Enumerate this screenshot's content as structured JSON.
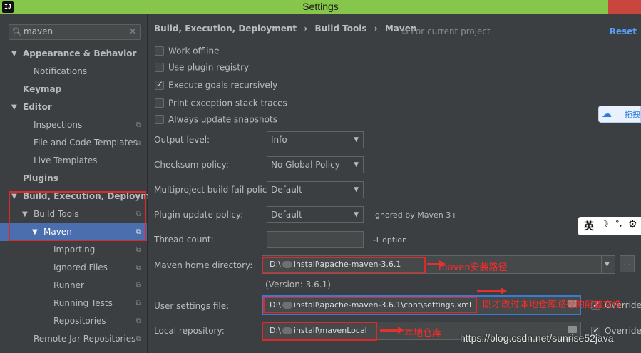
{
  "window": {
    "title": "Settings",
    "app_icon_text": "IJ"
  },
  "search": {
    "value": "maven",
    "clear": "✕"
  },
  "sidebar": {
    "items": [
      {
        "label": "Appearance & Behavior",
        "arrow": "▼"
      },
      {
        "label": "Notifications"
      },
      {
        "label": "Keymap"
      },
      {
        "label": "Editor",
        "arrow": "▼"
      },
      {
        "label": "Inspections"
      },
      {
        "label": "File and Code Templates"
      },
      {
        "label": "Live Templates"
      },
      {
        "label": "Plugins"
      },
      {
        "label": "Build, Execution, Deployment",
        "arrow": "▼"
      },
      {
        "label": "Build Tools",
        "arrow": "▼"
      },
      {
        "label": "Maven",
        "arrow": "▼"
      },
      {
        "label": "Importing"
      },
      {
        "label": "Ignored Files"
      },
      {
        "label": "Runner"
      },
      {
        "label": "Running Tests"
      },
      {
        "label": "Repositories"
      },
      {
        "label": "Remote Jar Repositories"
      }
    ]
  },
  "breadcrumb": {
    "part1": "Build, Execution, Deployment",
    "sep1": "›",
    "part2": "Build Tools",
    "sep2": "›",
    "part3": "Maven"
  },
  "scope": "For current project",
  "reset": "Reset",
  "checkboxes": [
    {
      "label": "Work offline",
      "checked": false
    },
    {
      "label": "Use plugin registry",
      "checked": false
    },
    {
      "label": "Execute goals recursively",
      "checked": true
    },
    {
      "label": "Print exception stack traces",
      "checked": false
    },
    {
      "label": "Always update snapshots",
      "checked": false
    }
  ],
  "form": {
    "output_level": {
      "label": "Output level:",
      "value": "Info"
    },
    "checksum_policy": {
      "label": "Checksum policy:",
      "value": "No Global Policy"
    },
    "multiproject_fail": {
      "label": "Multiproject build fail policy:",
      "value": "Default"
    },
    "plugin_update": {
      "label": "Plugin update policy:",
      "value": "Default",
      "hint": "ignored by Maven 3+"
    },
    "thread_count": {
      "label": "Thread count:",
      "value": "",
      "hint": "-T option"
    },
    "maven_home": {
      "label": "Maven home directory:",
      "prefix": "D:\\",
      "suffix": "install\\apache-maven-3.6.1",
      "version": "(Version: 3.6.1)",
      "browse": "..."
    },
    "user_settings": {
      "label": "User settings file:",
      "prefix": "D:\\",
      "suffix": "install\\apache-maven-3.6.1\\conf\\settings.xml",
      "override": "Override"
    },
    "local_repo": {
      "label": "Local repository:",
      "prefix": "D:\\",
      "suffix": "install\\mavenLocal",
      "override": "Override"
    }
  },
  "annotations": {
    "maven_home": "maven安装路径",
    "user_settings": "刚才改过本地仓库路径的配置文件",
    "local_repo": "本地仓库"
  },
  "overlays": {
    "baidu_text": "拖拽",
    "ime_char": "英",
    "ime_moon": "☽",
    "ime_dots": "°,",
    "ime_gear": "⚙",
    "watermark": "https://blog.csdn.net/sunrise52java"
  }
}
